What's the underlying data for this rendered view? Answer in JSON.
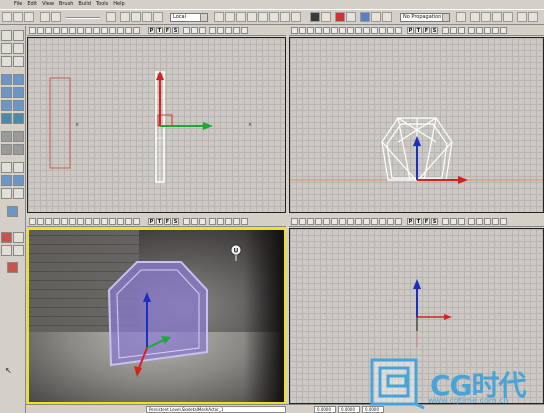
{
  "menu": {
    "items": [
      "File",
      "Edit",
      "View",
      "Brush",
      "Build",
      "Tools",
      "Help"
    ]
  },
  "toolbar": {
    "coordinate_system": "Local",
    "propagation": "No Propagation"
  },
  "viewport_buttons": [
    "P",
    "T",
    "F",
    "S"
  ],
  "viewports": {
    "top_left": {
      "name": "side-view"
    },
    "top_right": {
      "name": "front-view"
    },
    "bottom_left": {
      "name": "perspective-view",
      "active": true
    },
    "bottom_right": {
      "name": "top-view"
    }
  },
  "statusbar": {
    "selection": "Persistent Level.SkeletalMeshActor_1",
    "coord_x": "0.0000",
    "coord_y": "0.0000",
    "coord_z": "0.0000"
  },
  "watermark": {
    "brand": "CG时代",
    "url": "www.cgtime.com.cn"
  },
  "colors": {
    "active_viewport_border": "#f0e020",
    "axis_x": "#1fa83a",
    "axis_y": "#d62020",
    "axis_z": "#1a2ec0",
    "watermark": "#4aa3d8",
    "mesh_purple": "#8a7acc"
  }
}
